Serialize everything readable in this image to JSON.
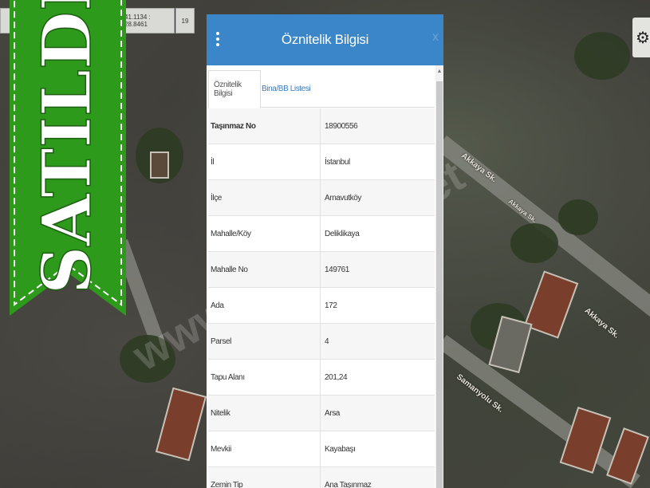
{
  "banner": {
    "text": "SATILDI",
    "color": "#2e9a1c"
  },
  "toolbar": {
    "coords": "41.1134 : 28.8461",
    "zoom": "19"
  },
  "map": {
    "watermark": "www.emlaklar.net",
    "roads": [
      "Akkaya Sk.",
      "Akkaya Sk.",
      "Akkaya Sk.",
      "Samanyolu Sk."
    ]
  },
  "icons": {
    "settings": "gear-icon",
    "menu": "kebab-menu-icon",
    "close": "close-icon"
  },
  "panel": {
    "title": "Öznitelik Bilgisi",
    "close_label": "x",
    "header_color": "#3a86c8",
    "tabs": [
      {
        "label": "Öznitelik Bilgisi",
        "active": true
      },
      {
        "label": "Bina/BB Listesi",
        "active": false
      }
    ],
    "rows": [
      {
        "key": "Taşınmaz No",
        "value": "18900556"
      },
      {
        "key": "İl",
        "value": "İstanbul"
      },
      {
        "key": "İlçe",
        "value": "Arnavutköy"
      },
      {
        "key": "Mahalle/Köy",
        "value": "Deliklikaya"
      },
      {
        "key": "Mahalle No",
        "value": "149761"
      },
      {
        "key": "Ada",
        "value": "172"
      },
      {
        "key": "Parsel",
        "value": "4"
      },
      {
        "key": "Tapu Alanı",
        "value": "201,24"
      },
      {
        "key": "Nitelik",
        "value": "Arsa"
      },
      {
        "key": "Mevkii",
        "value": "Kayabaşı"
      },
      {
        "key": "Zemin Tip",
        "value": "Ana Taşınmaz"
      }
    ]
  }
}
